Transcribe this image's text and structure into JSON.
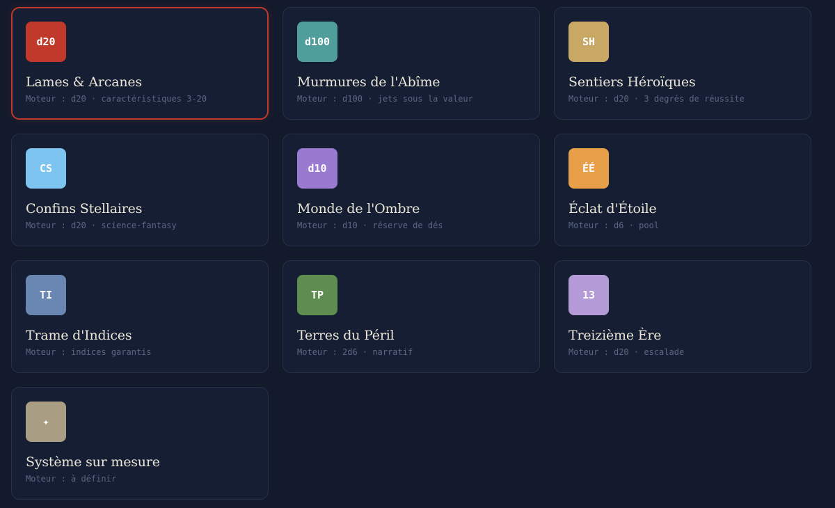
{
  "systems": [
    {
      "badge": "d20",
      "badge_color": "#c0392b",
      "icon": "d20-badge-icon",
      "title": "Lames & Arcanes",
      "engine": "Moteur : d20 · caractéristiques 3-20",
      "selected": true
    },
    {
      "badge": "d100",
      "badge_color": "#4f9e9c",
      "icon": "d100-badge-icon",
      "title": "Murmures de l'Abîme",
      "engine": "Moteur : d100 · jets sous la valeur",
      "selected": false
    },
    {
      "badge": "SH",
      "badge_color": "#c9a865",
      "icon": "sh-badge-icon",
      "title": "Sentiers Héroïques",
      "engine": "Moteur : d20 · 3 degrés de réussite",
      "selected": false
    },
    {
      "badge": "CS",
      "badge_color": "#7ec4f0",
      "icon": "cs-badge-icon",
      "title": "Confins Stellaires",
      "engine": "Moteur : d20 · science-fantasy",
      "selected": false
    },
    {
      "badge": "d10",
      "badge_color": "#9a7ad0",
      "icon": "d10-badge-icon",
      "title": "Monde de l'Ombre",
      "engine": "Moteur : d10 · réserve de dés",
      "selected": false
    },
    {
      "badge": "ÉÉ",
      "badge_color": "#e8a048",
      "icon": "ee-badge-icon",
      "title": "Éclat d'Étoile",
      "engine": "Moteur : d6 · pool",
      "selected": false
    },
    {
      "badge": "TI",
      "badge_color": "#6a87b3",
      "icon": "ti-badge-icon",
      "title": "Trame d'Indices",
      "engine": "Moteur : indices garantis",
      "selected": false
    },
    {
      "badge": "TP",
      "badge_color": "#5e8d4f",
      "icon": "tp-badge-icon",
      "title": "Terres du Péril",
      "engine": "Moteur : 2d6 · narratif",
      "selected": false
    },
    {
      "badge": "13",
      "badge_color": "#b59ad8",
      "icon": "thirteen-badge-icon",
      "title": "Treizième Ère",
      "engine": "Moteur : d20 · escalade",
      "selected": false
    },
    {
      "badge": "✦",
      "badge_color": "#a99e84",
      "icon": "sparkle-icon",
      "title": "Système sur mesure",
      "engine": "Moteur : à définir",
      "selected": false
    }
  ]
}
